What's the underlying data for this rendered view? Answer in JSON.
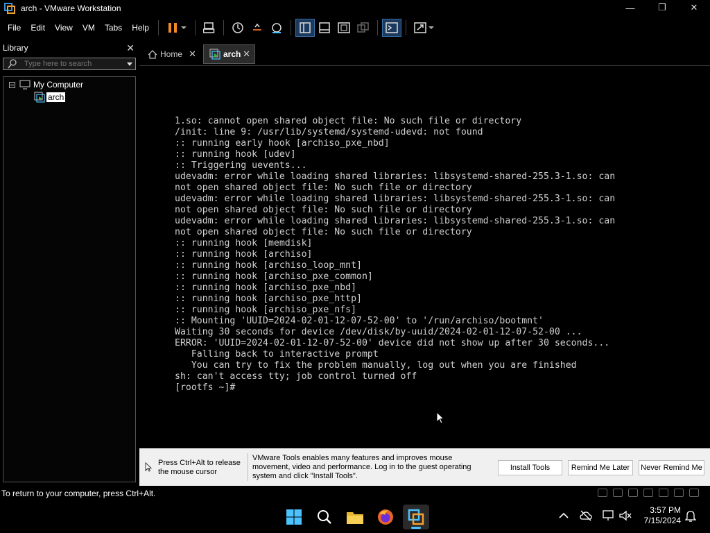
{
  "window": {
    "title": "arch - VMware Workstation",
    "minimize_icon": "—",
    "restore_icon": "❐",
    "close_icon": "✕"
  },
  "menu": {
    "items": [
      "File",
      "Edit",
      "View",
      "VM",
      "Tabs",
      "Help"
    ]
  },
  "library": {
    "title": "Library",
    "search_placeholder": "Type here to search",
    "tree": {
      "root": "My Computer",
      "child": "arch"
    }
  },
  "tabs": [
    {
      "label": "Home",
      "active": false
    },
    {
      "label": "arch",
      "active": true
    }
  ],
  "console": {
    "lines": [
      "1.so: cannot open shared object file: No such file or directory",
      "/init: line 9: /usr/lib/systemd/systemd-udevd: not found",
      ":: running early hook [archiso_pxe_nbd]",
      ":: running hook [udev]",
      ":: Triggering uevents...",
      "udevadm: error while loading shared libraries: libsystemd-shared-255.3-1.so: can",
      "not open shared object file: No such file or directory",
      "udevadm: error while loading shared libraries: libsystemd-shared-255.3-1.so: can",
      "not open shared object file: No such file or directory",
      "udevadm: error while loading shared libraries: libsystemd-shared-255.3-1.so: can",
      "not open shared object file: No such file or directory",
      ":: running hook [memdisk]",
      ":: running hook [archiso]",
      ":: running hook [archiso_loop_mnt]",
      ":: running hook [archiso_pxe_common]",
      ":: running hook [archiso_pxe_nbd]",
      ":: running hook [archiso_pxe_http]",
      ":: running hook [archiso_pxe_nfs]",
      ":: Mounting 'UUID=2024-02-01-12-07-52-00' to '/run/archiso/bootmnt'",
      "Waiting 30 seconds for device /dev/disk/by-uuid/2024-02-01-12-07-52-00 ...",
      "ERROR: 'UUID=2024-02-01-12-07-52-00' device did not show up after 30 seconds...",
      "   Falling back to interactive prompt",
      "   You can try to fix the problem manually, log out when you are finished",
      "sh: can't access tty; job control turned off",
      "[rootfs ~]#"
    ]
  },
  "notification": {
    "release_hint": "Press Ctrl+Alt to release the mouse cursor",
    "message": "VMware Tools enables many features and improves mouse movement, video and performance. Log in to the guest operating system and click \"Install Tools\".",
    "install_label": "Install Tools",
    "remind_label": "Remind Me Later",
    "never_label": "Never Remind Me"
  },
  "status": {
    "text": "To return to your computer, press Ctrl+Alt."
  },
  "taskbar": {
    "time": "3:57 PM",
    "date": "7/15/2024"
  },
  "colors": {
    "accent": "#4cc2ff",
    "pause_orange": "#f08a24",
    "notify_bg": "#f0f0f0"
  }
}
